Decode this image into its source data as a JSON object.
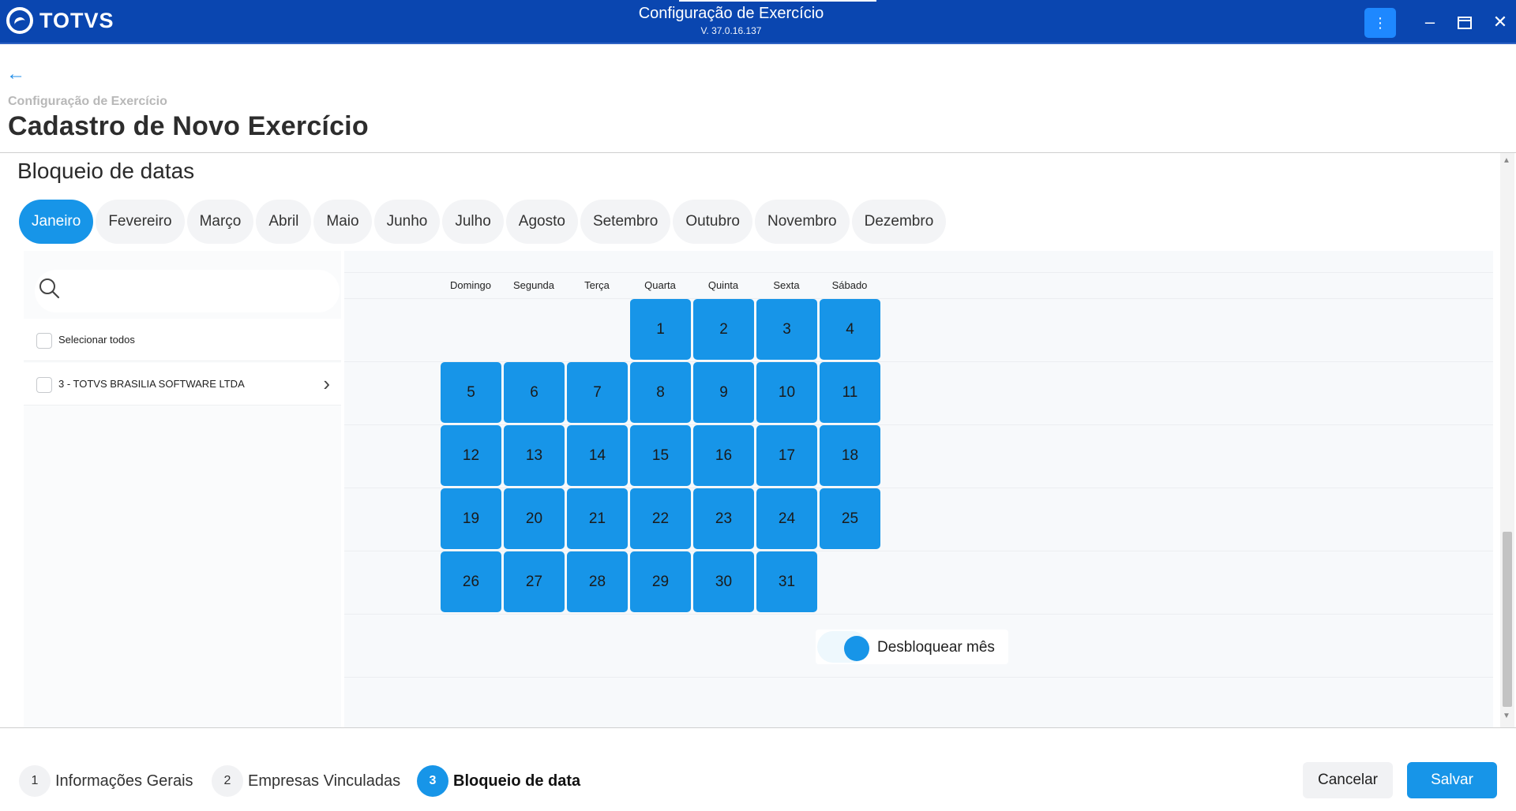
{
  "window": {
    "app_name": "TOTVS",
    "title": "Configuração de Exercício",
    "version": "V. 37.0.16.137",
    "menu_icon": "kebab-icon",
    "controls": [
      "minimize-icon",
      "maximize-icon",
      "close-icon"
    ]
  },
  "header": {
    "breadcrumb": "Configuração de Exercício",
    "title": "Cadastro de Novo Exercício"
  },
  "section": {
    "title": "Bloqueio de datas"
  },
  "months": [
    "Janeiro",
    "Fevereiro",
    "Março",
    "Abril",
    "Maio",
    "Junho",
    "Julho",
    "Agosto",
    "Setembro",
    "Outubro",
    "Novembro",
    "Dezembro"
  ],
  "selected_month": "Janeiro",
  "companies": {
    "search_placeholder": "",
    "select_all_label": "Selecionar todos",
    "items": [
      {
        "label": "3 - TOTVS BRASILIA SOFTWARE LTDA"
      }
    ]
  },
  "calendar": {
    "weekdays": [
      "Domingo",
      "Segunda",
      "Terça",
      "Quarta",
      "Quinta",
      "Sexta",
      "Sábado"
    ],
    "weeks": [
      [
        "",
        "",
        "",
        "1",
        "2",
        "3",
        "4"
      ],
      [
        "5",
        "6",
        "7",
        "8",
        "9",
        "10",
        "11"
      ],
      [
        "12",
        "13",
        "14",
        "15",
        "16",
        "17",
        "18"
      ],
      [
        "19",
        "20",
        "21",
        "22",
        "23",
        "24",
        "25"
      ],
      [
        "26",
        "27",
        "28",
        "29",
        "30",
        "31",
        ""
      ]
    ],
    "blocked_color": "#1795e8",
    "unlock_label": "Desbloquear mês"
  },
  "steps": [
    {
      "num": "1",
      "label": "Informações Gerais"
    },
    {
      "num": "2",
      "label": "Empresas Vinculadas"
    },
    {
      "num": "3",
      "label": "Bloqueio de data"
    }
  ],
  "footer": {
    "cancel_label": "Cancelar",
    "save_label": "Salvar"
  },
  "colors": {
    "titlebar": "#0a46b0",
    "accent": "#1795e8"
  }
}
